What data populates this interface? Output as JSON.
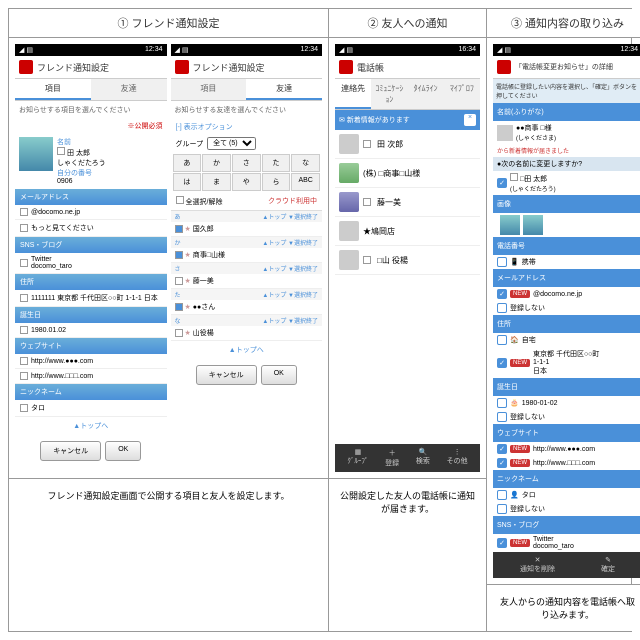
{
  "cols": [
    {
      "header": "① フレンド通知設定",
      "caption": "フレンド通知設定画面で公開する項目と友人を設定します。"
    },
    {
      "header": "② 友人への通知",
      "caption": "公開設定した友人の電話帳に通知が届きます。"
    },
    {
      "header": "③ 通知内容の取り込み",
      "caption": "友人からの通知内容を電話帳へ取り込みます。"
    }
  ],
  "status": {
    "time": "12:34",
    "time2": "16:34"
  },
  "app": {
    "title": "フレンド通知設定",
    "phonebook": "電話帳",
    "detail": "「電話帳変更お知らせ」の詳細"
  },
  "tabs": {
    "items": "項目",
    "friends": "友達"
  },
  "hint": {
    "items": "お知らせする項目を選んでください",
    "friends": "お知らせする友達を選んでください",
    "req": "※公開必須"
  },
  "profile": {
    "nameLbl": "名前",
    "name": "田 太郎",
    "kana": "しゃくだたろう",
    "numLbl": "自分の番号",
    "num": "0906"
  },
  "sections": {
    "mail": "メールアドレス",
    "sns": "SNS・ブログ",
    "addr": "住所",
    "bday": "誕生日",
    "web": "ウェブサイト",
    "nick": "ニックネーム",
    "phone": "電話番号",
    "img": "画像",
    "name": "名前(ふりがな)"
  },
  "vals": {
    "mail": "@docomo.ne.jp",
    "mail2": "もっと見てください",
    "twitter": "Twitter",
    "twhandle": "docomo_taro",
    "addr": "1111111 東京都 千代田区○○町 1-1-1 日本",
    "bday": "1980.01.02",
    "web1": "http://www.●●●.com",
    "web2": "http://www.□□□.com",
    "nick": "タロ",
    "phone": "携帯",
    "home": "自宅",
    "reg": "登録しない",
    "bday2": "1980-01-02"
  },
  "toplink": "▲トップへ",
  "btns": {
    "cancel": "キャンセル",
    "ok": "OK"
  },
  "opt": {
    "header": "[-] 表示オプション",
    "group": "グループ",
    "all": "全て (5)"
  },
  "keys": [
    "あ",
    "か",
    "さ",
    "た",
    "な",
    "は",
    "ま",
    "や",
    "ら",
    "ABC"
  ],
  "toggle": {
    "all": "全選択/解除",
    "cloud": "クラウド利用中"
  },
  "cats": [
    "あ",
    "か",
    "さ",
    "た",
    "な"
  ],
  "friends": [
    "国久郎",
    "商事□山様",
    "藤一美",
    "●●さん",
    "山役楊"
  ],
  "ftop": {
    "top": "▲トップ",
    "sel": "▼選択終了"
  },
  "banner": "新着情報があります",
  "contacts": [
    "田 次郎",
    "(株) □商事□山様",
    "藤一美",
    "★鳩岡店",
    "□山 役楊"
  ],
  "tabs2": [
    "連絡先",
    "ｺﾐｭﾆｹｰｼｮﾝ",
    "ﾀｲﾑﾗｲﾝ",
    "ﾏｲﾌﾟﾛﾌ"
  ],
  "bicons": [
    "ｸﾞﾙｰﾌﾟ",
    "登録",
    "検索",
    "その他"
  ],
  "detail": {
    "hint": "電話帳に登録したい内容を選択し、「確定」ボタンを押してください",
    "name": "●●商事  □様",
    "kana": "(しゃくださま)",
    "from": "から新着情報が届きました",
    "q": "●次の名前に変更しますか?",
    "newname": "□田 太郎",
    "newkana": "(しゃくだたろう)",
    "addr2": "東京都 千代田区○○町\n1-1-1\n日本"
  },
  "bbtns": {
    "del": "通知を削除",
    "conf": "確定"
  }
}
